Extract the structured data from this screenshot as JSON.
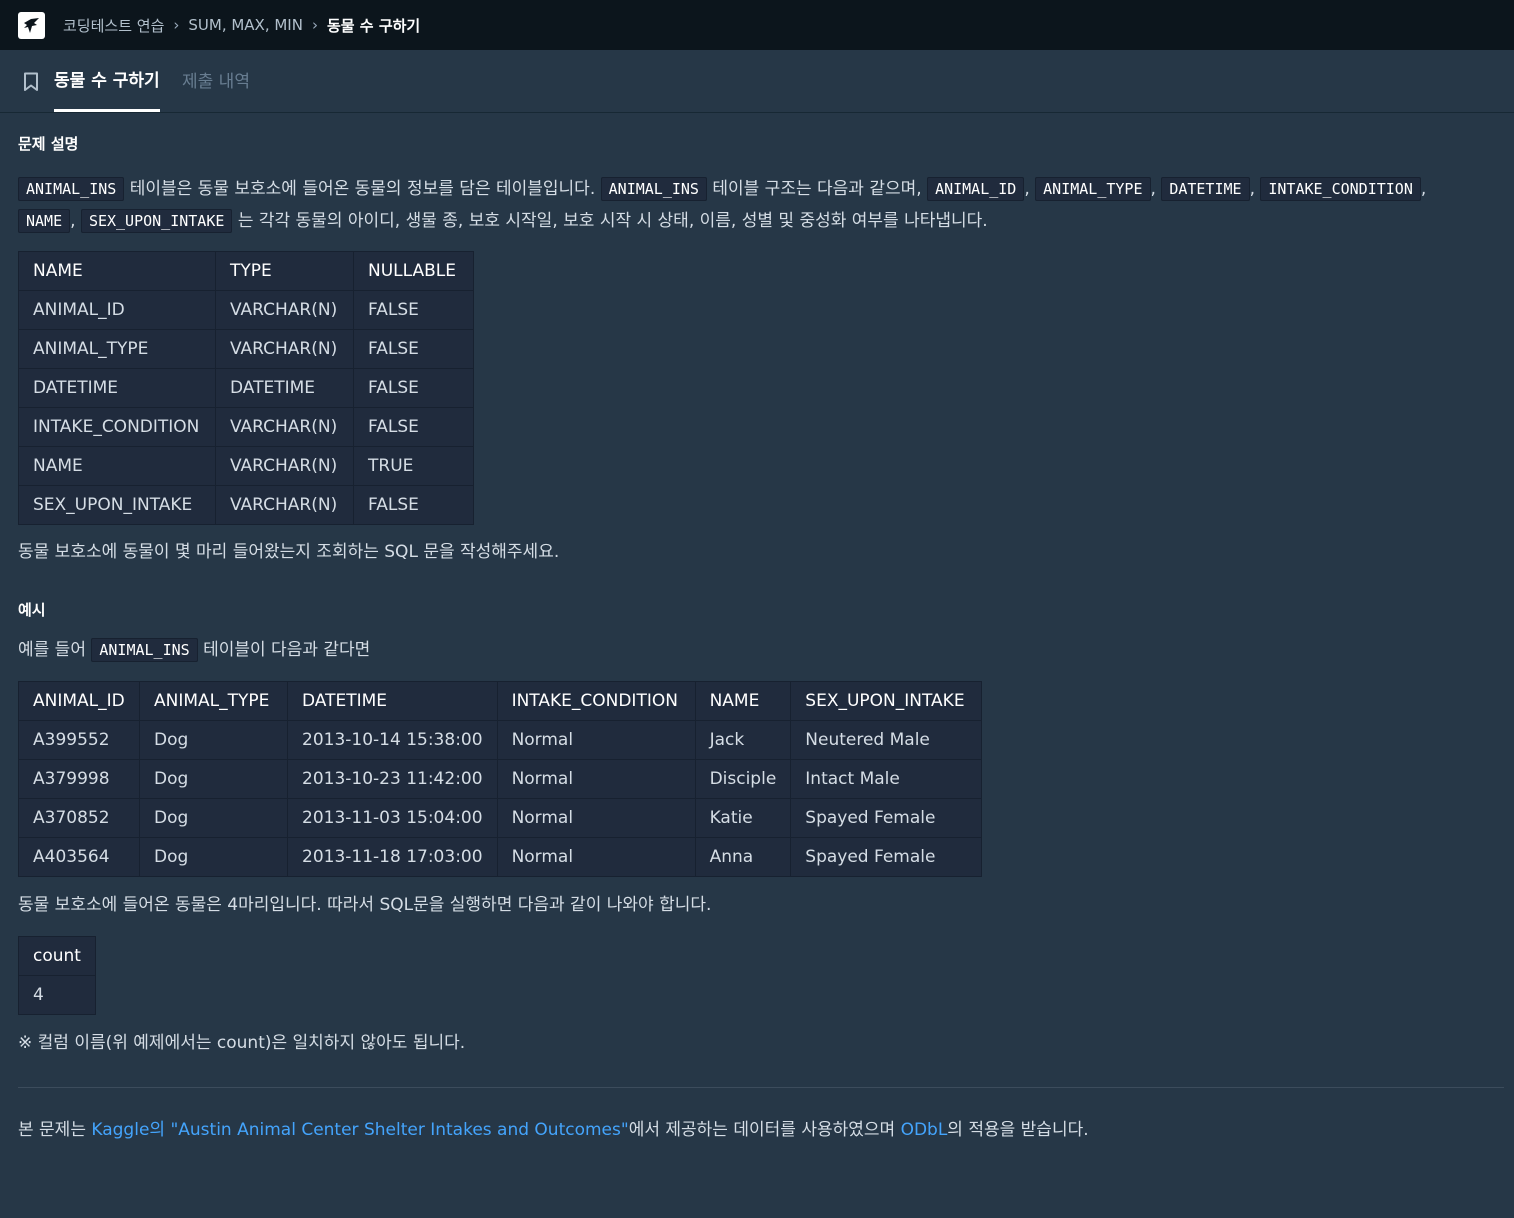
{
  "breadcrumb": {
    "items": [
      "코딩테스트 연습",
      "SUM, MAX, MIN",
      "동물 수 구하기"
    ]
  },
  "tabs": {
    "active": "동물 수 구하기",
    "inactive": "제출 내역"
  },
  "problem": {
    "section_title": "문제 설명",
    "intro": {
      "code_table": "ANIMAL_INS",
      "t1": "테이블은 동물 보호소에 들어온 동물의 정보를 담은 테이블입니다.",
      "code_table2": "ANIMAL_INS",
      "t2": "테이블 구조는 다음과 같으며,",
      "col1": "ANIMAL_ID",
      "col2": "ANIMAL_TYPE",
      "col3": "DATETIME",
      "col4": "INTAKE_CONDITION",
      "col5": "NAME",
      "col6": "SEX_UPON_INTAKE",
      "comma": ",",
      "t3": "는 각각 동물의 아이디, 생물 종, 보호 시작일, 보호 시작 시 상태, 이름, 성별 및 중성화 여부를 나타냅니다."
    },
    "schema_table": {
      "headers": [
        "NAME",
        "TYPE",
        "NULLABLE"
      ],
      "rows": [
        [
          "ANIMAL_ID",
          "VARCHAR(N)",
          "FALSE"
        ],
        [
          "ANIMAL_TYPE",
          "VARCHAR(N)",
          "FALSE"
        ],
        [
          "DATETIME",
          "DATETIME",
          "FALSE"
        ],
        [
          "INTAKE_CONDITION",
          "VARCHAR(N)",
          "FALSE"
        ],
        [
          "NAME",
          "VARCHAR(N)",
          "TRUE"
        ],
        [
          "SEX_UPON_INTAKE",
          "VARCHAR(N)",
          "FALSE"
        ]
      ]
    },
    "question": "동물 보호소에 동물이 몇 마리 들어왔는지 조회하는 SQL 문을 작성해주세요."
  },
  "example": {
    "section_title": "예시",
    "lead_before": "예를 들어",
    "lead_code": "ANIMAL_INS",
    "lead_after": "테이블이 다음과 같다면",
    "data_table": {
      "headers": [
        "ANIMAL_ID",
        "ANIMAL_TYPE",
        "DATETIME",
        "INTAKE_CONDITION",
        "NAME",
        "SEX_UPON_INTAKE"
      ],
      "rows": [
        [
          "A399552",
          "Dog",
          "2013-10-14 15:38:00",
          "Normal",
          "Jack",
          "Neutered Male"
        ],
        [
          "A379998",
          "Dog",
          "2013-10-23 11:42:00",
          "Normal",
          "Disciple",
          "Intact Male"
        ],
        [
          "A370852",
          "Dog",
          "2013-11-03 15:04:00",
          "Normal",
          "Katie",
          "Spayed Female"
        ],
        [
          "A403564",
          "Dog",
          "2013-11-18 17:03:00",
          "Normal",
          "Anna",
          "Spayed Female"
        ]
      ]
    },
    "result_text": "동물 보호소에 들어온 동물은 4마리입니다. 따라서 SQL문을 실행하면 다음과 같이 나와야 합니다.",
    "result_table": {
      "header": "count",
      "value": "4"
    },
    "note": "※ 컬럼 이름(위 예제에서는 count)은 일치하지 않아도 됩니다."
  },
  "footer": {
    "prefix": "본 문제는",
    "kaggle_link": "Kaggle의 \"Austin Animal Center Shelter Intakes and Outcomes\"",
    "middle": "에서 제공하는 데이터를 사용하였으며",
    "odbl_link": "ODbL",
    "suffix": "의 적용을 받습니다."
  },
  "colors": {
    "topbar_bg": "#0c151c",
    "page_bg": "#263747",
    "table_bg": "#202b3d",
    "link": "#44a4fc"
  }
}
